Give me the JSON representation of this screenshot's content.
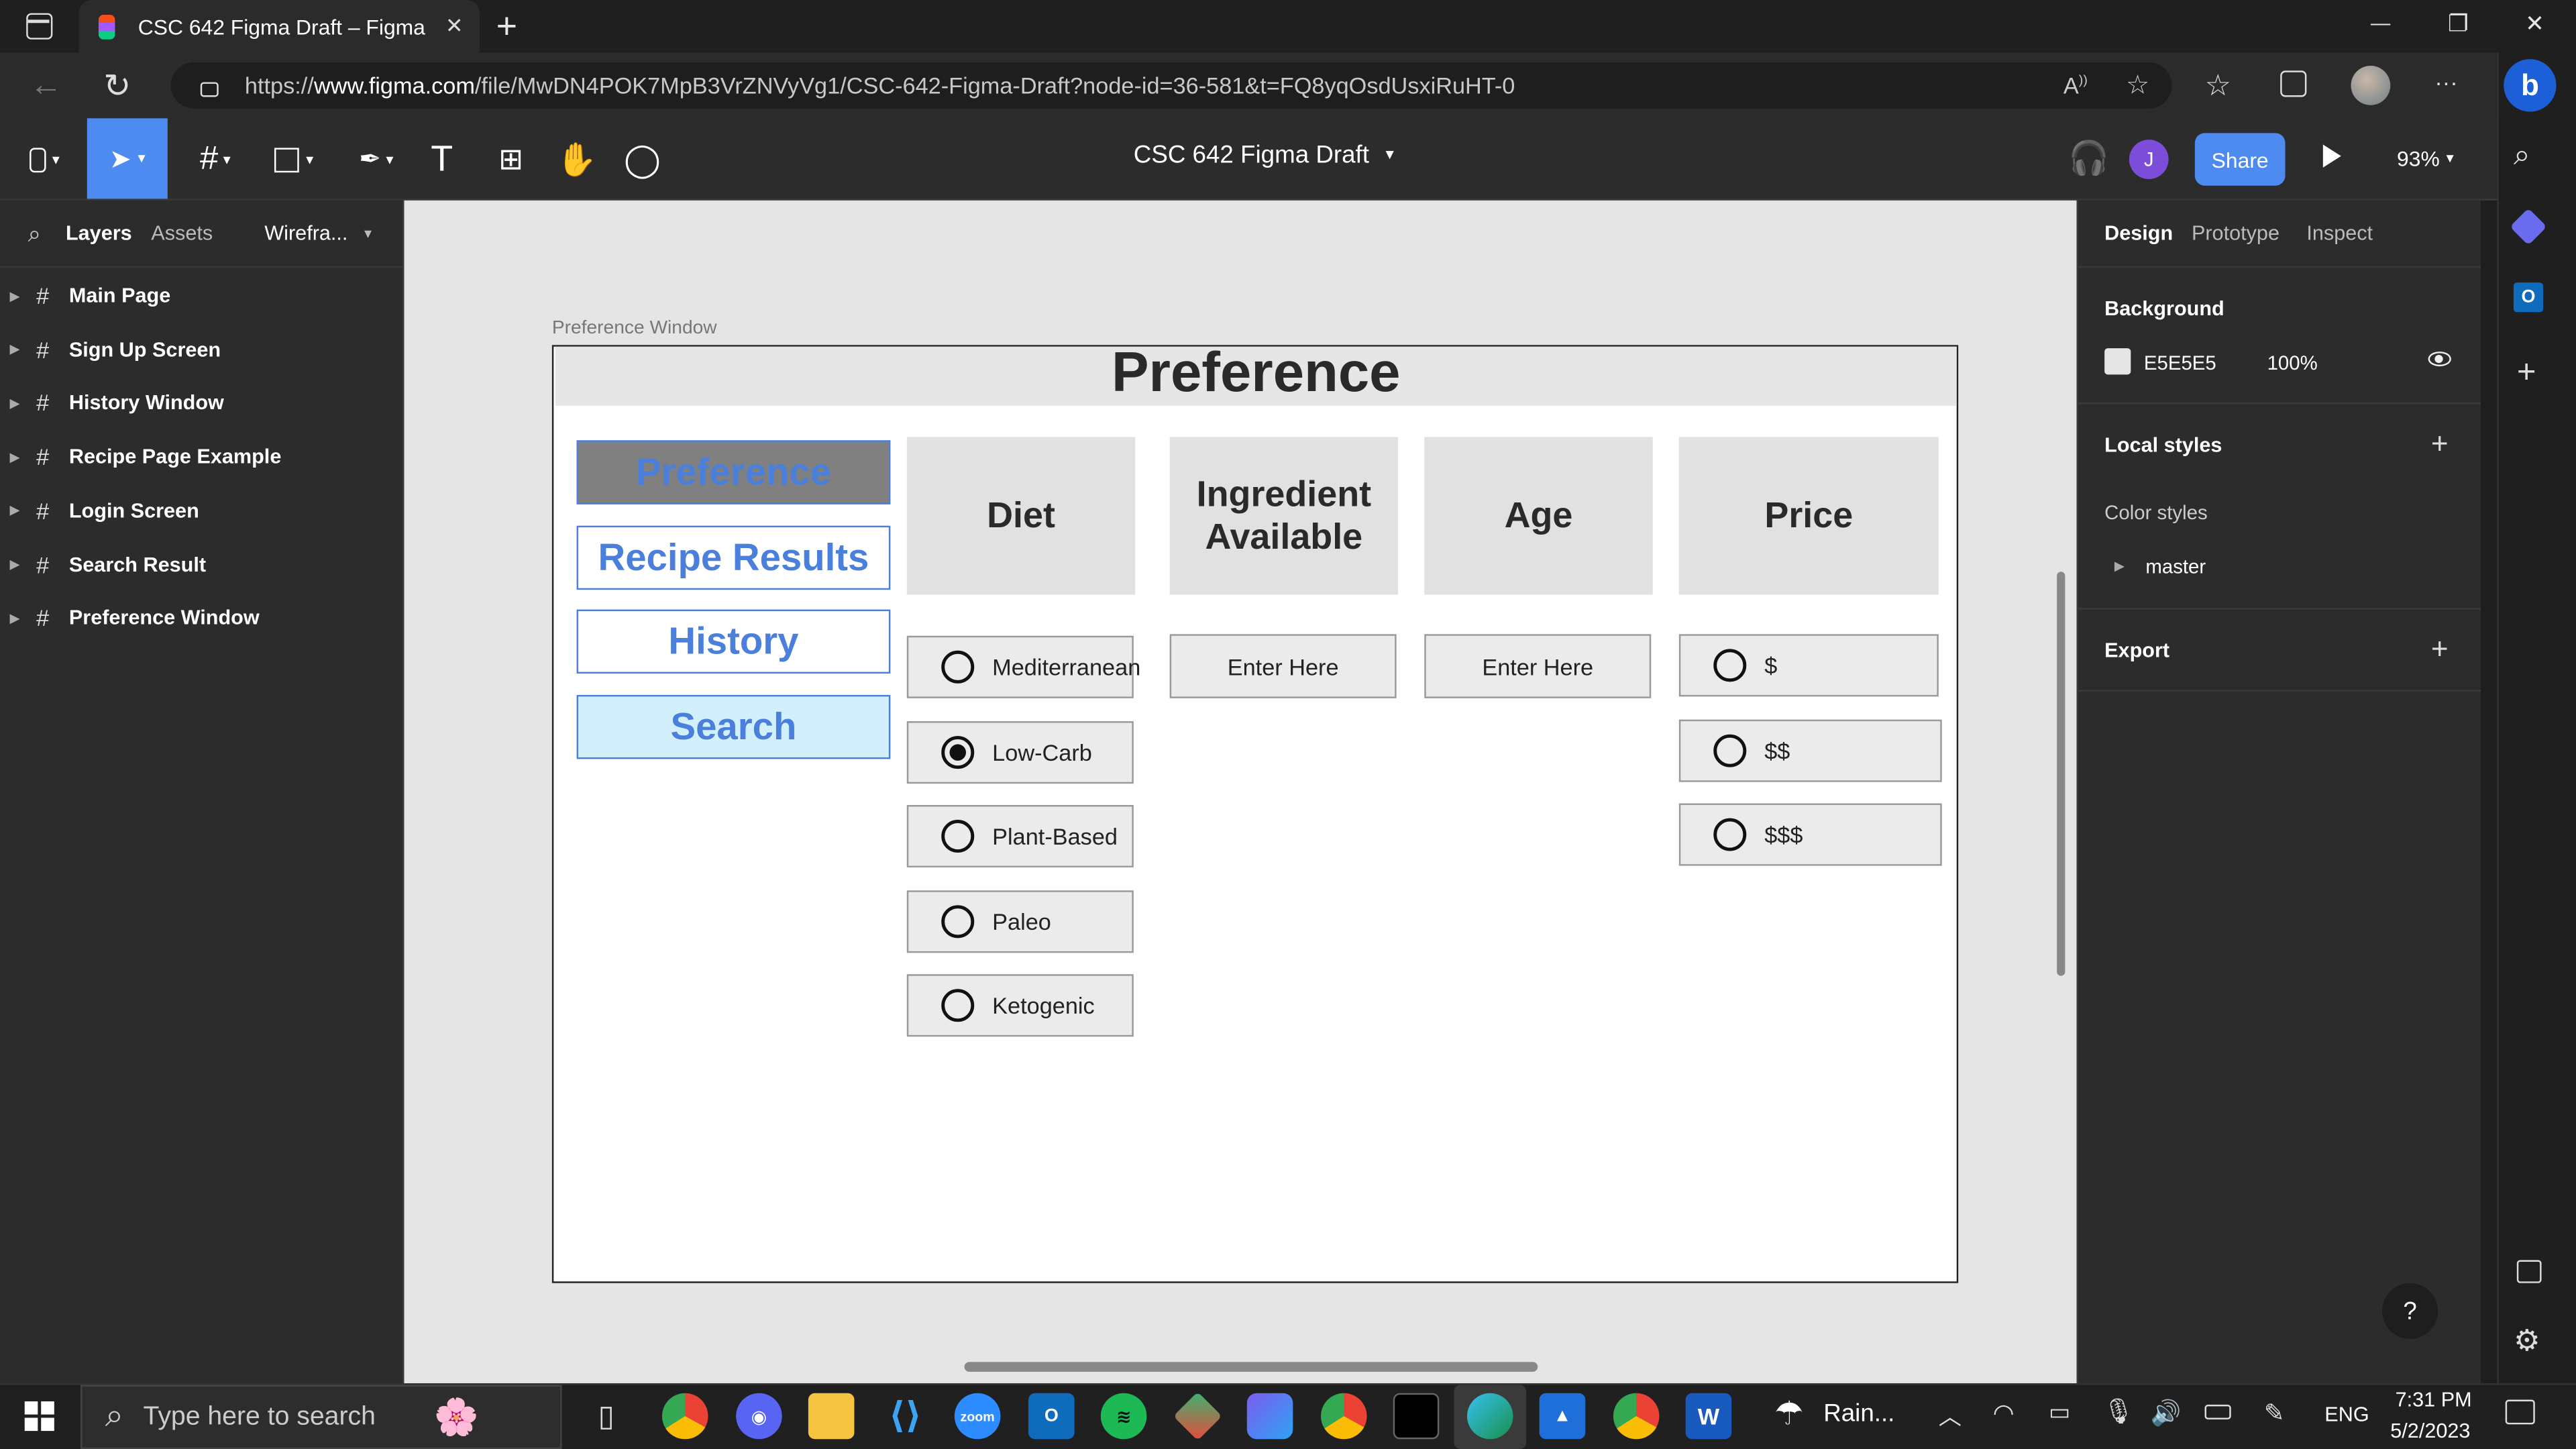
{
  "browser": {
    "tab_title": "CSC 642 Figma Draft – Figma",
    "new_tab": "+",
    "url_prefix": "https://",
    "url_domain": "www.figma.com",
    "url_path": "/file/MwDN4POK7MpB3VrZNVyVg1/CSC-642-Figma-Draft?node-id=36-581&t=FQ8yqOsdUsxiRuHT-0",
    "minimize": "—",
    "restore": "❐",
    "close": "✕",
    "more": "···"
  },
  "toolbar": {
    "file_name": "CSC 642 Figma Draft",
    "user_initial": "J",
    "share_label": "Share",
    "zoom": "93%"
  },
  "left_panel": {
    "tabs": [
      "Layers",
      "Assets"
    ],
    "page_selector": "Wirefra...",
    "layers": [
      "Main Page",
      "Sign Up Screen",
      "History Window",
      "Recipe Page Example",
      "Login Screen",
      "Search Result",
      "Preference Window"
    ]
  },
  "canvas": {
    "frame_label": "Preference Window",
    "title": "Preference",
    "nav_buttons": [
      "Preference",
      "Recipe Results",
      "History",
      "Search"
    ],
    "columns": {
      "diet": "Diet",
      "ingredient": "Ingredient Available",
      "age": "Age",
      "price": "Price"
    },
    "diet_options": [
      {
        "label": "Mediterranean",
        "selected": false
      },
      {
        "label": "Low-Carb",
        "selected": true
      },
      {
        "label": "Plant-Based",
        "selected": false
      },
      {
        "label": "Paleo",
        "selected": false
      },
      {
        "label": "Ketogenic",
        "selected": false
      }
    ],
    "ingredient_placeholder": "Enter Here",
    "age_placeholder": "Enter Here",
    "price_options": [
      {
        "label": "$",
        "selected": false
      },
      {
        "label": "$$",
        "selected": false
      },
      {
        "label": "$$$",
        "selected": false
      }
    ]
  },
  "right_panel": {
    "tabs": [
      "Design",
      "Prototype",
      "Inspect"
    ],
    "background_title": "Background",
    "background_hex": "E5E5E5",
    "background_opacity": "100%",
    "local_styles": "Local styles",
    "color_styles": "Color styles",
    "master": "master",
    "export": "Export",
    "help": "?"
  },
  "taskbar": {
    "search_placeholder": "Type here to search",
    "weather": "Rain...",
    "language": "ENG",
    "time": "7:31 PM",
    "date": "5/2/2023",
    "zoom_app": "zoom",
    "word_app": "W"
  },
  "colors": {
    "accent": "#4a7fdb",
    "share_button": "#4d8bf0",
    "selected_tool": "#4d8bf0",
    "canvas_bg": "#E5E5E5"
  }
}
